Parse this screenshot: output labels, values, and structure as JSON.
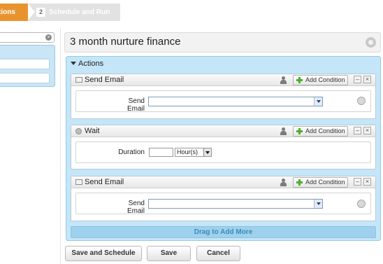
{
  "wizard": {
    "step1": {
      "label": "tions"
    },
    "step2": {
      "number": "2",
      "label": "Schedule and Run"
    }
  },
  "campaign": {
    "title": "3 month nurture finance"
  },
  "actions_panel": {
    "header": "Actions",
    "add_condition_label": "Add Condition",
    "minimize_glyph": "–",
    "close_glyph": "×",
    "cards": [
      {
        "type": "send-email",
        "title": "Send Email",
        "field_label": "Send Email",
        "selected_value": ""
      },
      {
        "type": "wait",
        "title": "Wait",
        "field_label": "Duration",
        "duration_value": "",
        "unit_value": "Hour(s)"
      },
      {
        "type": "send-email",
        "title": "Send Email",
        "field_label": "Send Email",
        "selected_value": ""
      }
    ],
    "drag_hint": "Drag to Add More"
  },
  "buttons": {
    "save_schedule": "Save and Schedule",
    "save": "Save",
    "cancel": "Cancel"
  },
  "colors": {
    "accent_orange": "#e8942e",
    "panel_blue": "#c4e6f8",
    "drag_blue": "#9ed1ed",
    "add_green": "#4caf2e"
  }
}
